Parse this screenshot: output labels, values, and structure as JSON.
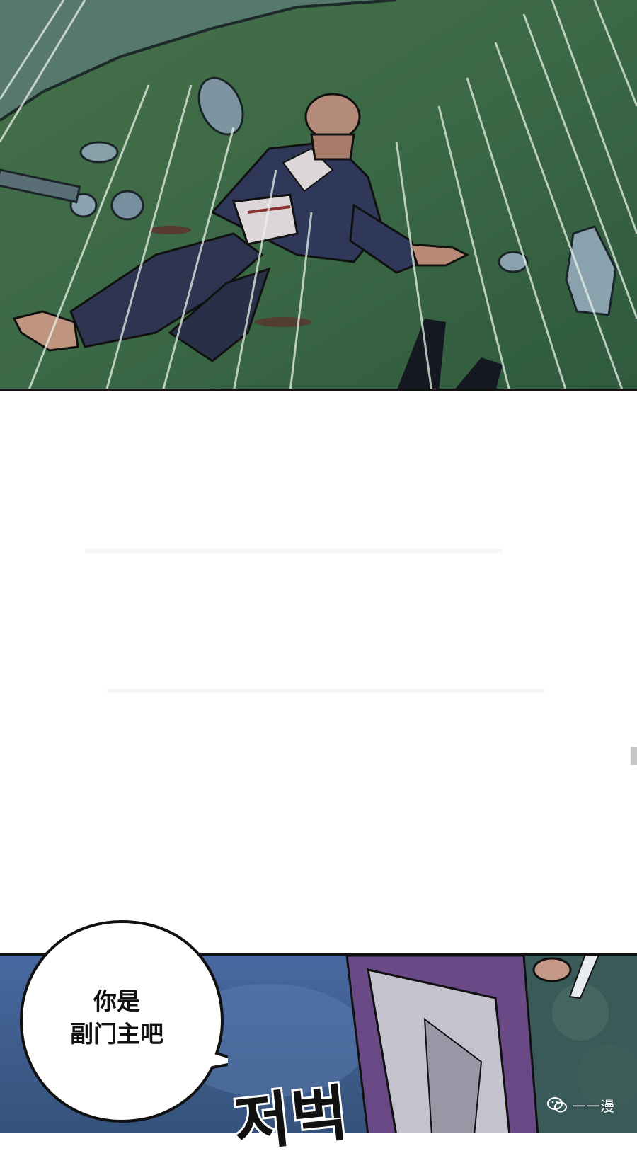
{
  "comic": {
    "speech_bubble": {
      "line1": "你是",
      "line2": "副门主吧"
    },
    "sound_effect": "저벅",
    "watermark": {
      "icon": "wechat-icon",
      "text": "一一漫"
    }
  },
  "colors": {
    "grass": "#3f6b47",
    "robe": "#2d3550",
    "sky_blue": "#3d5f8c",
    "purple_robe": "#6a4a86",
    "panel_border": "#111111"
  }
}
